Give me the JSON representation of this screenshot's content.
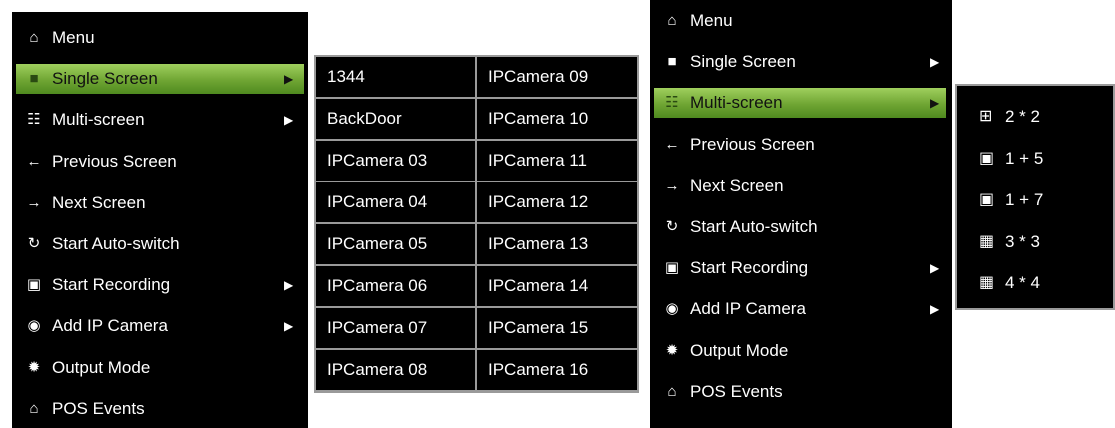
{
  "left_menu": {
    "items": [
      {
        "icon": "home-icon",
        "glyph": "⌂",
        "label": "Menu",
        "submenu": false,
        "active": false
      },
      {
        "icon": "single-screen-icon",
        "glyph": "■",
        "label": "Single Screen",
        "submenu": true,
        "active": true
      },
      {
        "icon": "multi-screen-icon",
        "glyph": "☷",
        "label": "Multi-screen",
        "submenu": true,
        "active": false
      },
      {
        "icon": "arrow-left-icon",
        "glyph": "←",
        "label": "Previous Screen",
        "submenu": false,
        "active": false
      },
      {
        "icon": "arrow-right-icon",
        "glyph": "→",
        "label": "Next Screen",
        "submenu": false,
        "active": false
      },
      {
        "icon": "refresh-icon",
        "glyph": "↻",
        "label": "Start Auto-switch",
        "submenu": false,
        "active": false
      },
      {
        "icon": "recording-icon",
        "glyph": "▣",
        "label": "Start Recording",
        "submenu": true,
        "active": false
      },
      {
        "icon": "add-camera-icon",
        "glyph": "◉",
        "label": "Add IP Camera",
        "submenu": true,
        "active": false
      },
      {
        "icon": "output-mode-icon",
        "glyph": "✹",
        "label": "Output Mode",
        "submenu": false,
        "active": false
      },
      {
        "icon": "home-icon",
        "glyph": "⌂",
        "label": "POS Events",
        "submenu": false,
        "active": false
      }
    ]
  },
  "camera_list": {
    "column1": [
      "1344",
      "BackDoor",
      "IPCamera 03",
      "IPCamera 04",
      "IPCamera 05",
      "IPCamera 06",
      "IPCamera 07",
      "IPCamera 08"
    ],
    "column2": [
      "IPCamera 09",
      "IPCamera 10",
      "IPCamera 11",
      "IPCamera 12",
      "IPCamera 13",
      "IPCamera 14",
      "IPCamera 15",
      "IPCamera 16"
    ]
  },
  "right_menu": {
    "items": [
      {
        "icon": "home-icon",
        "glyph": "⌂",
        "label": "Menu",
        "submenu": false,
        "active": false
      },
      {
        "icon": "single-screen-icon",
        "glyph": "■",
        "label": "Single Screen",
        "submenu": true,
        "active": false
      },
      {
        "icon": "multi-screen-icon",
        "glyph": "☷",
        "label": "Multi-screen",
        "submenu": true,
        "active": true
      },
      {
        "icon": "arrow-left-icon",
        "glyph": "←",
        "label": "Previous Screen",
        "submenu": false,
        "active": false
      },
      {
        "icon": "arrow-right-icon",
        "glyph": "→",
        "label": "Next Screen",
        "submenu": false,
        "active": false
      },
      {
        "icon": "refresh-icon",
        "glyph": "↻",
        "label": "Start Auto-switch",
        "submenu": false,
        "active": false
      },
      {
        "icon": "recording-icon",
        "glyph": "▣",
        "label": "Start Recording",
        "submenu": true,
        "active": false
      },
      {
        "icon": "add-camera-icon",
        "glyph": "◉",
        "label": "Add IP Camera",
        "submenu": true,
        "active": false
      },
      {
        "icon": "output-mode-icon",
        "glyph": "✹",
        "label": "Output Mode",
        "submenu": false,
        "active": false
      },
      {
        "icon": "home-icon",
        "glyph": "⌂",
        "label": "POS Events",
        "submenu": false,
        "active": false
      }
    ]
  },
  "layouts": {
    "items": [
      {
        "icon": "grid-2x2-icon",
        "glyph": "⊞",
        "label": "2 * 2"
      },
      {
        "icon": "layout-1-plus-5-icon",
        "glyph": "▣",
        "label": "1 + 5"
      },
      {
        "icon": "layout-1-plus-7-icon",
        "glyph": "▣",
        "label": "1 + 7"
      },
      {
        "icon": "grid-3x3-icon",
        "glyph": "▦",
        "label": "3 * 3"
      },
      {
        "icon": "grid-4x4-icon",
        "glyph": "▦",
        "label": "4 * 4"
      }
    ]
  },
  "submenu_arrow_glyph": "▶",
  "colors": {
    "panel": "#000000",
    "active_green": "#6fa533",
    "border": "#9a9a9a",
    "text": "#ffffff"
  }
}
